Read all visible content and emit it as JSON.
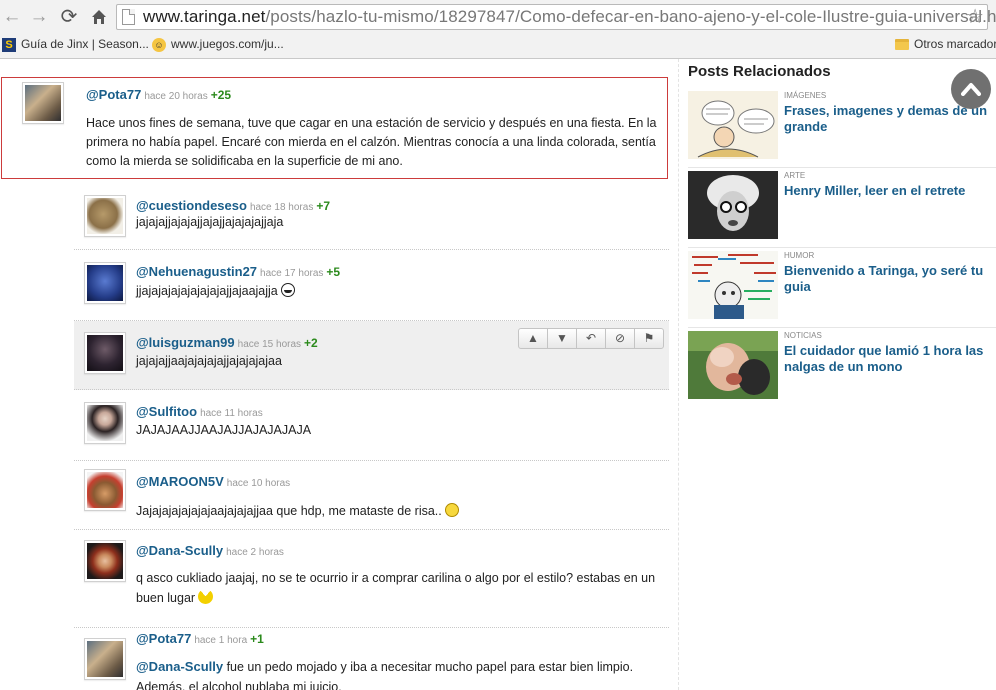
{
  "browser": {
    "url_domain": "www.taringa.net",
    "url_path": "/posts/hazlo-tu-mismo/18297847/Como-defecar-en-bano-ajeno-y-el-cole-Ilustre-guia-universal.html",
    "bookmarks": [
      {
        "label": "Guía de Jinx | Season..."
      },
      {
        "label": "www.juegos.com/ju..."
      }
    ],
    "other_bookmarks": "Otros marcadores"
  },
  "op_comment": {
    "user": "@Pota77",
    "time": "hace 20 horas",
    "votes": "+25",
    "text": "Hace unos fines de semana, tuve que cagar en una estación de servicio y después en una fiesta. En la primera no había papel. Encaré con mierda en el calzón. Mientras conocía a una linda colorada, sentía como la mierda se solidificaba en la superficie de mi ano."
  },
  "replies": [
    {
      "user": "@cuestiondeseso",
      "time": "hace 18 horas",
      "votes": "+7",
      "text": "jajajajjajajajjajajjajajajajjaja"
    },
    {
      "user": "@Nehuenagustin27",
      "time": "hace 17 horas",
      "votes": "+5",
      "text": "jjajajajajajajajajajjajaajajja"
    },
    {
      "user": "@luisguzman99",
      "time": "hace 15 horas",
      "votes": "+2",
      "text": "jajajajjaajajajajajjajajajajaa"
    },
    {
      "user": "@Sulfitoo",
      "time": "hace 11 horas",
      "votes": "",
      "text": "JAJAJAAJJAAJAJJAJAJAJAJA"
    },
    {
      "user": "@MAROON5V",
      "time": "hace 10 horas",
      "votes": "",
      "text": "Jajajajajajajajaajajajajjaa que hdp, me mataste de risa.."
    },
    {
      "user": "@Dana-Scully",
      "time": "hace 2 horas",
      "votes": "",
      "text": "q asco cukliado jaajaj, no se te ocurrio ir a comprar carilina o algo por el estilo? estabas en un buen lugar"
    },
    {
      "user": "@Pota77",
      "time": "hace 1 hora",
      "votes": "+1",
      "mention": "@Dana-Scully",
      "text": " fue un pedo mojado y iba a necesitar mucho papel para estar bien limpio.",
      "text2": "Además, el alcohol nublaba mi juicio."
    }
  ],
  "sidebar": {
    "title": "Posts Relacionados",
    "posts": [
      {
        "category": "IMÁGENES",
        "title": "Frases, imagenes y demas de un grande"
      },
      {
        "category": "ARTE",
        "title": "Henry Miller, leer en el retrete"
      },
      {
        "category": "HUMOR",
        "title": "Bienvenido a Taringa, yo seré tu guia"
      },
      {
        "category": "NOTICIAS",
        "title": "El cuidador que lamió 1 hora las nalgas de un mono"
      }
    ]
  },
  "icons": {
    "back": "arrow-left-icon",
    "forward": "arrow-right-icon",
    "reload": "reload-icon",
    "home": "home-icon",
    "star": "star-icon",
    "scroll_top": "chevron-up-icon",
    "actions": [
      "thumbs-up-icon",
      "thumbs-down-icon",
      "reply-icon",
      "block-icon",
      "flag-icon"
    ]
  },
  "colors": {
    "link": "#1a5e8a",
    "votes": "#2b8a1c",
    "highlight_border": "#cc3b3b"
  }
}
